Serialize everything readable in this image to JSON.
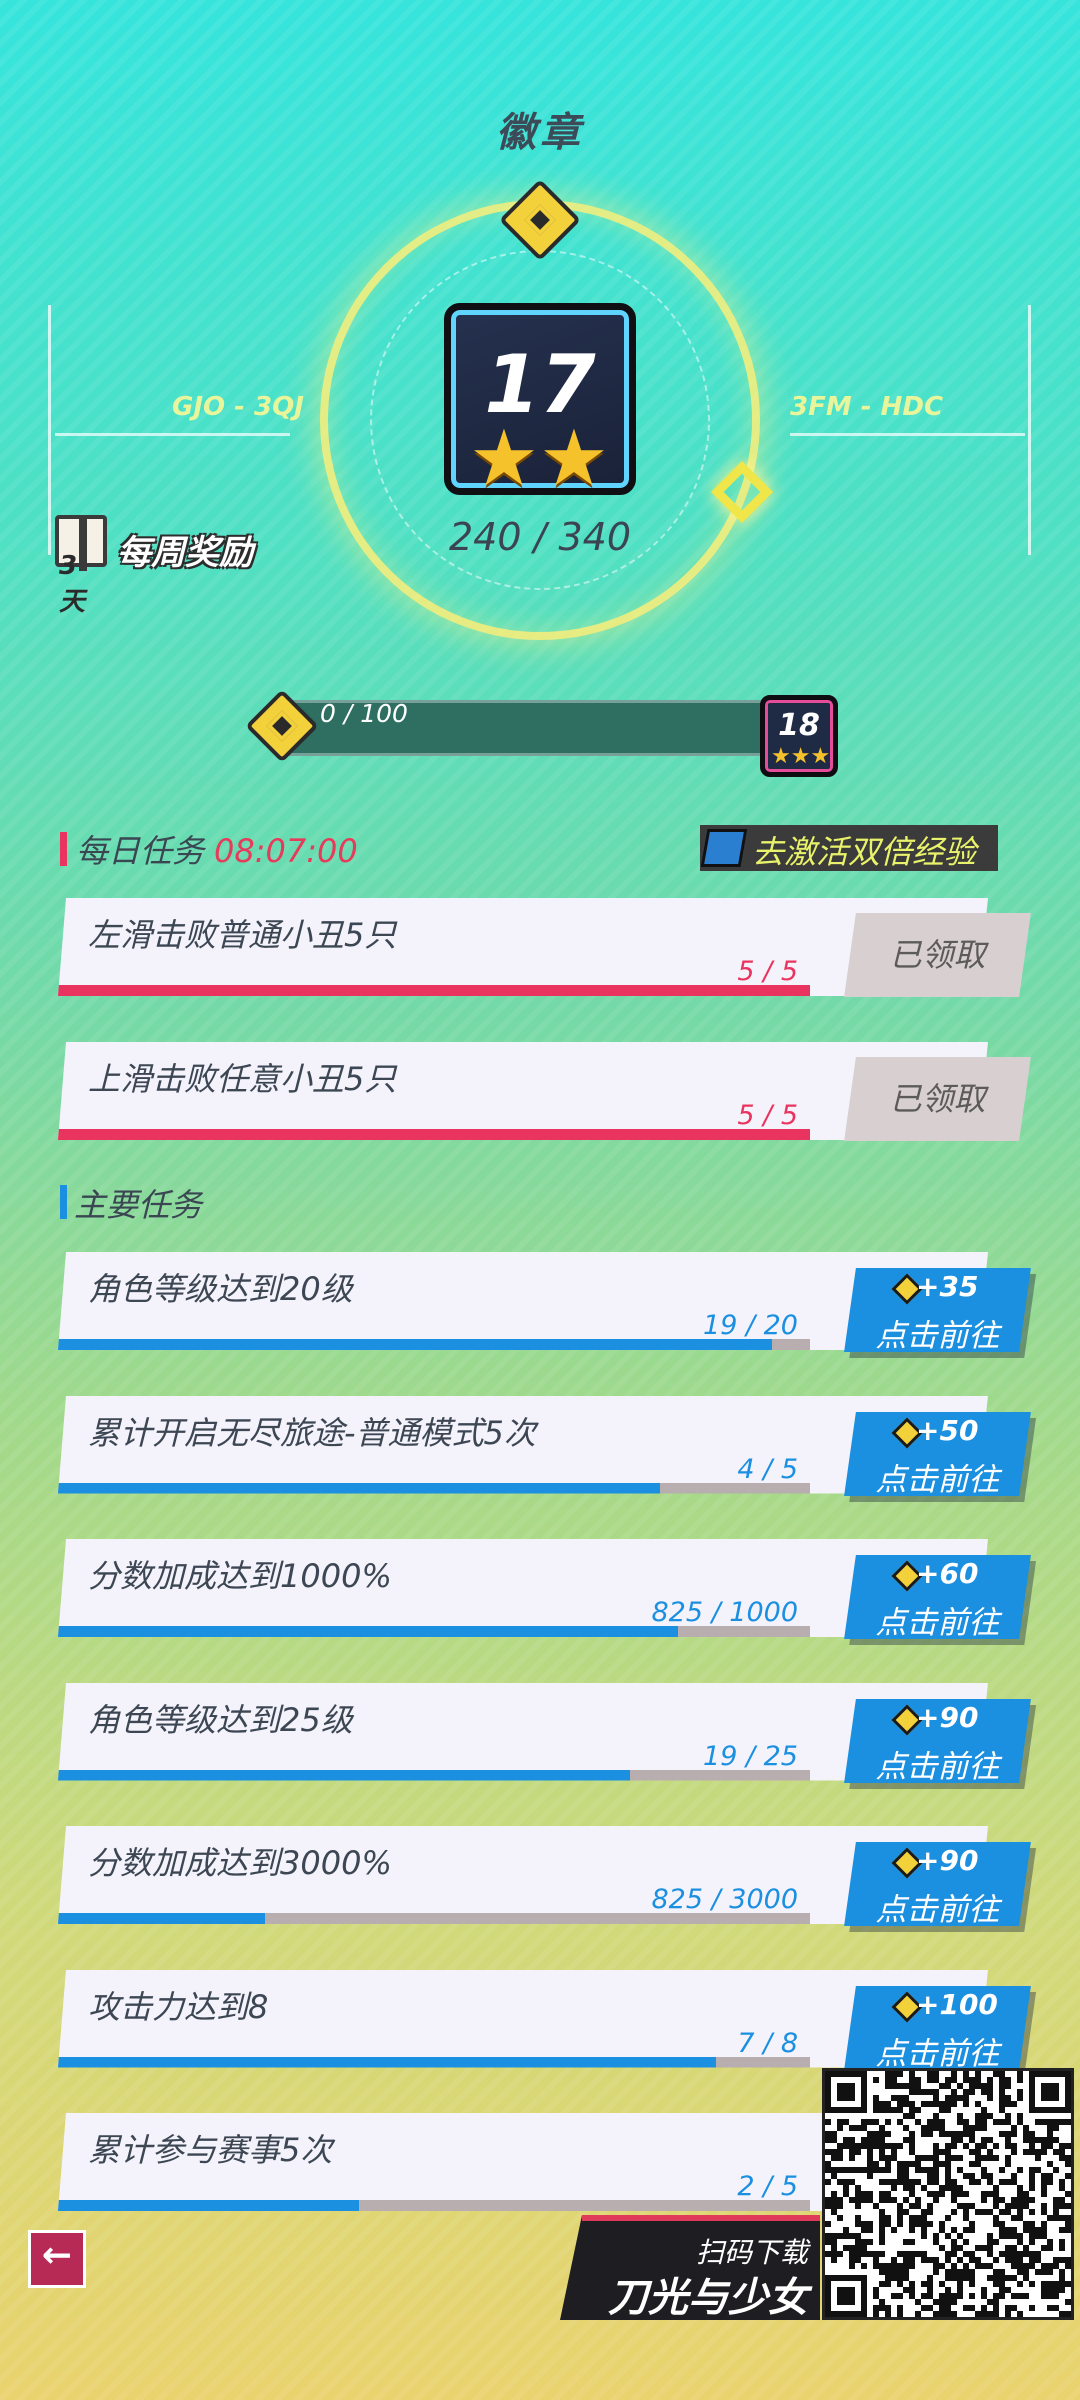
{
  "header": {
    "title": "徽章",
    "range_left": "GJO - 3QJ",
    "range_right": "3FM - HDC",
    "badge_level": "17",
    "badge_stars": 2,
    "progress": "240 / 340",
    "weekly_reward_label": "每周奖励",
    "weekly_reward_days": "3天"
  },
  "level_bar": {
    "progress_text": "0 / 100",
    "progress_fraction": 0.0,
    "next_level": "18",
    "next_stars": 3
  },
  "daily": {
    "title": "每日任务",
    "timer": "08:07:00",
    "double_exp_label": "去激活双倍经验",
    "tasks": [
      {
        "title": "左滑击败普通小丑5只",
        "count": "5 / 5",
        "fraction": 1.0,
        "button": "已领取"
      },
      {
        "title": "上滑击败任意小丑5只",
        "count": "5 / 5",
        "fraction": 1.0,
        "button": "已领取"
      }
    ]
  },
  "main": {
    "title": "主要任务",
    "tasks": [
      {
        "title": "角色等级达到20级",
        "count": "19 / 20",
        "fraction": 0.95,
        "reward": "+35",
        "button": "点击前往"
      },
      {
        "title": "累计开启无尽旅途-普通模式5次",
        "count": "4 / 5",
        "fraction": 0.8,
        "reward": "+50",
        "button": "点击前往"
      },
      {
        "title": "分数加成达到1000%",
        "count": "825 / 1000",
        "fraction": 0.825,
        "reward": "+60",
        "button": "点击前往"
      },
      {
        "title": "角色等级达到25级",
        "count": "19 / 25",
        "fraction": 0.76,
        "reward": "+90",
        "button": "点击前往"
      },
      {
        "title": "分数加成达到3000%",
        "count": "825 / 3000",
        "fraction": 0.275,
        "reward": "+90",
        "button": "点击前往"
      },
      {
        "title": "攻击力达到8",
        "count": "7 / 8",
        "fraction": 0.875,
        "reward": "+100",
        "button": "点击前往"
      },
      {
        "title": "累计参与赛事5次",
        "count": "2 / 5",
        "fraction": 0.4,
        "reward": "",
        "button": ""
      }
    ]
  },
  "promo": {
    "subtitle": "扫码下载",
    "game_name": "刀光与少女"
  },
  "colors": {
    "daily_fill": "#e8345f",
    "main_fill": "#1b8fe0",
    "count_daily": "#e8345f",
    "count_main": "#1b8fe0"
  },
  "icons": {
    "back": "back-arrow-icon",
    "coin": "diamond-coin-icon",
    "gift": "gift-box-icon"
  }
}
